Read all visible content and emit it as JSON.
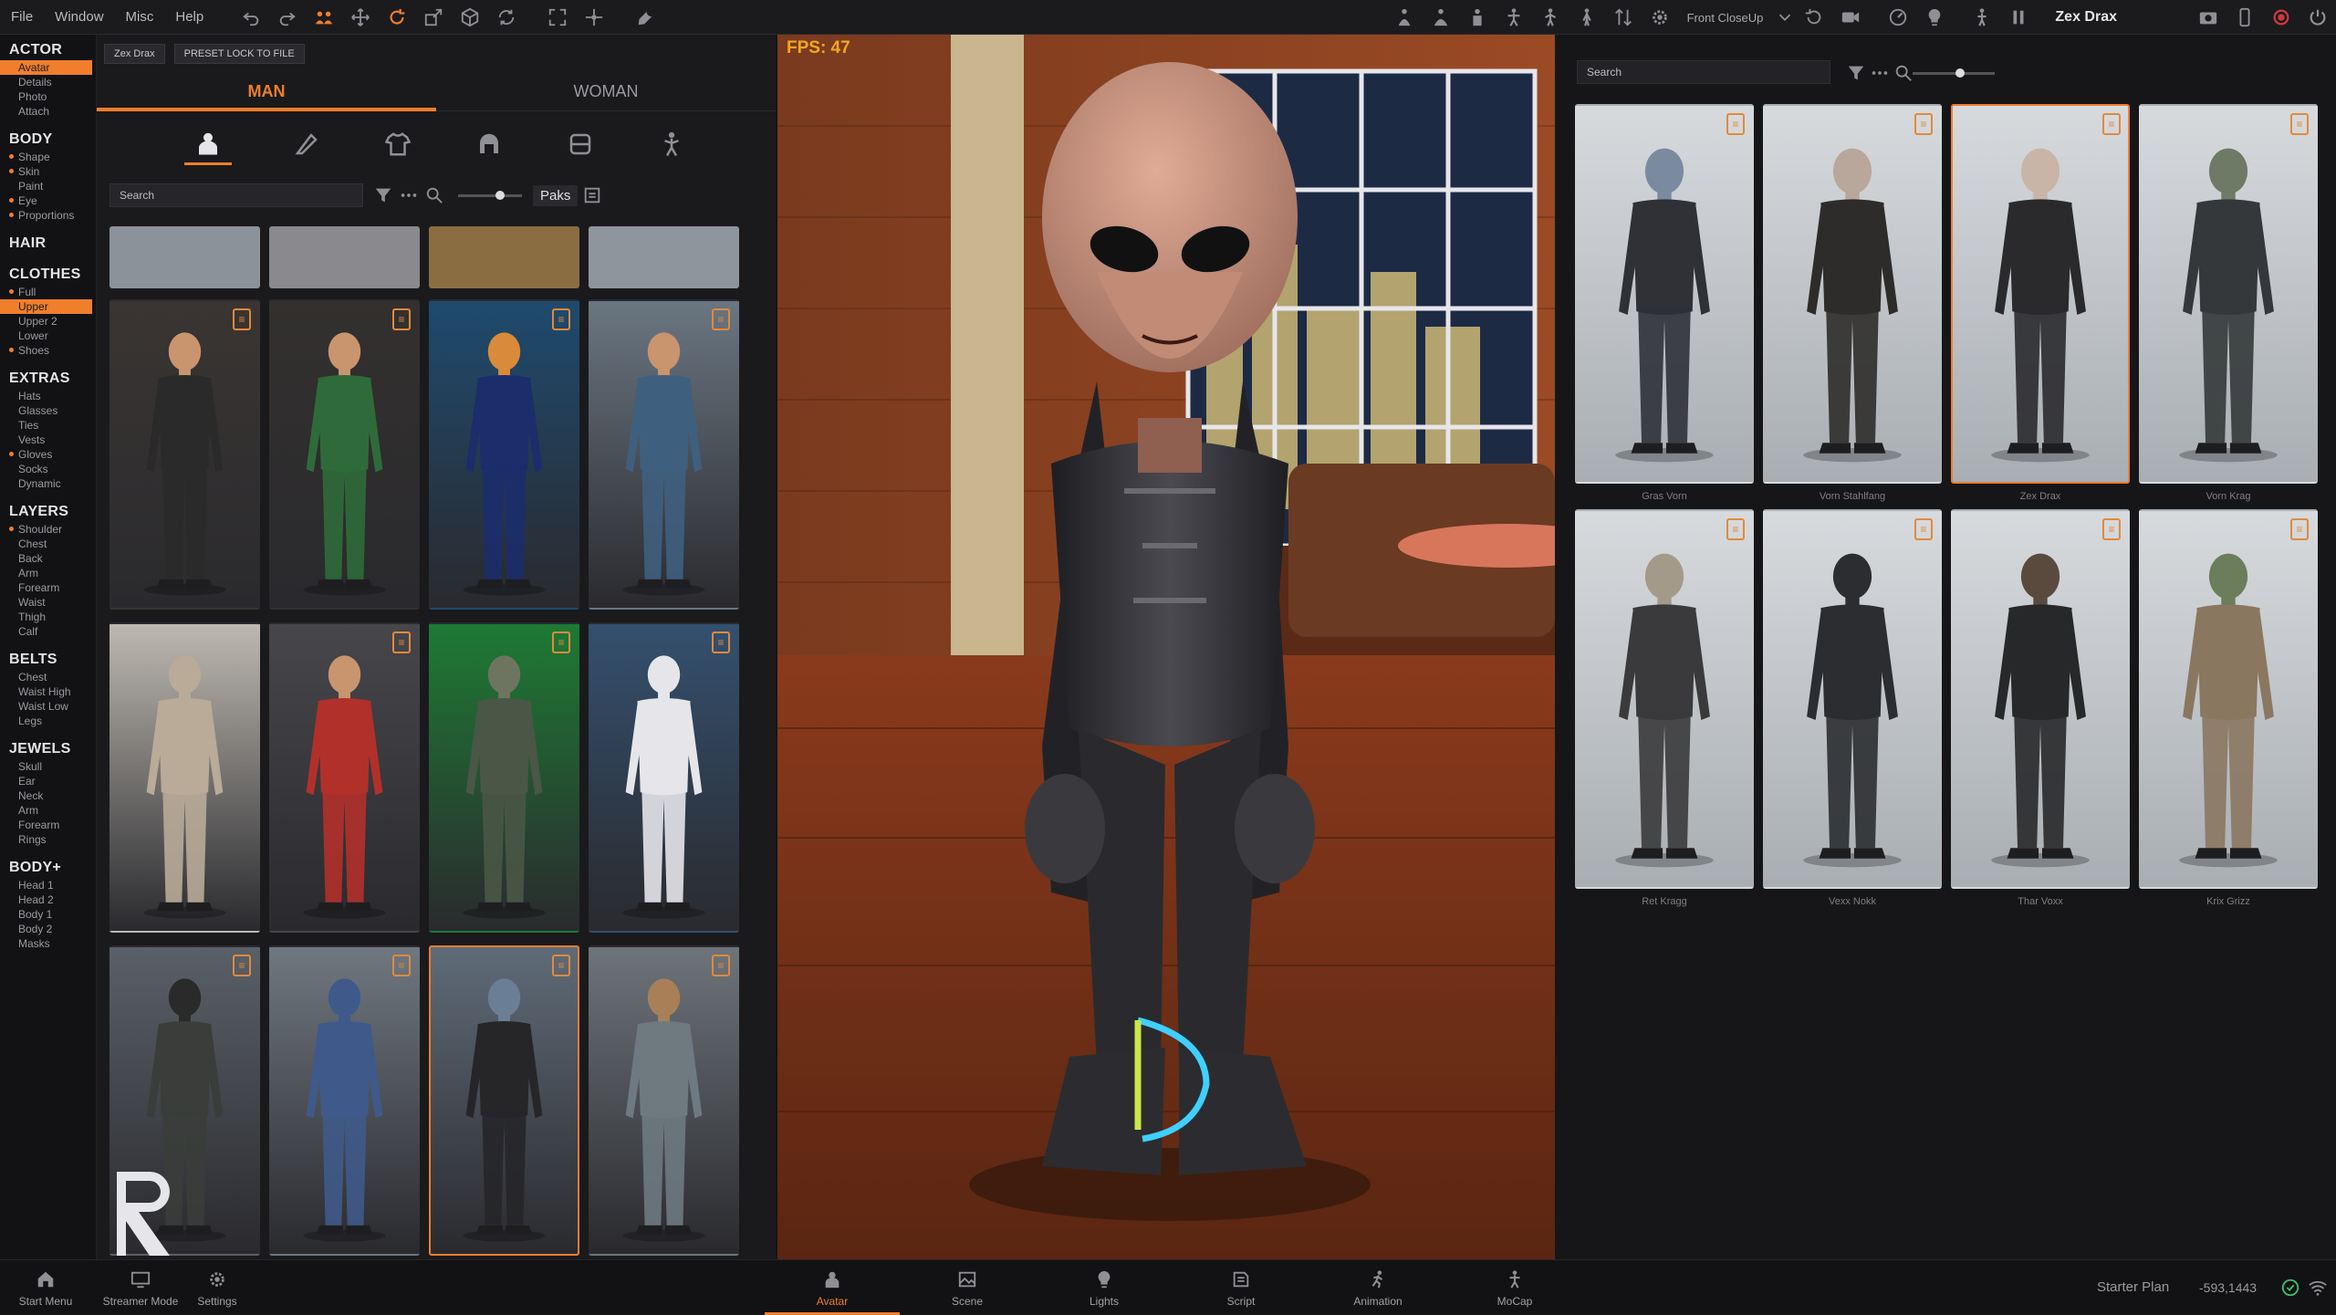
{
  "menu": [
    "File",
    "Window",
    "Misc",
    "Help"
  ],
  "toolbar": {
    "camera": "Front CloseUp",
    "actor": "Zex Drax"
  },
  "leftnav": [
    {
      "title": "ACTOR",
      "items": [
        {
          "label": "Avatar",
          "active": true
        },
        {
          "label": "Details"
        },
        {
          "label": "Photo"
        },
        {
          "label": "Attach"
        }
      ]
    },
    {
      "title": "BODY",
      "items": [
        {
          "label": "Shape",
          "dot": true
        },
        {
          "label": "Skin",
          "dot": true
        },
        {
          "label": "Paint"
        },
        {
          "label": "Eye",
          "dot": true
        },
        {
          "label": "Proportions",
          "dot": true
        }
      ]
    },
    {
      "title": "HAIR",
      "items": []
    },
    {
      "title": "CLOTHES",
      "items": [
        {
          "label": "Full",
          "dot": true
        },
        {
          "label": "Upper",
          "active": true
        },
        {
          "label": "Upper 2"
        },
        {
          "label": "Lower"
        },
        {
          "label": "Shoes",
          "dot": true
        }
      ]
    },
    {
      "title": "EXTRAS",
      "items": [
        {
          "label": "Hats"
        },
        {
          "label": "Glasses"
        },
        {
          "label": "Ties"
        },
        {
          "label": "Vests"
        },
        {
          "label": "Gloves",
          "dot": true
        },
        {
          "label": "Socks"
        },
        {
          "label": "Dynamic"
        }
      ]
    },
    {
      "title": "LAYERS",
      "items": [
        {
          "label": "Shoulder",
          "dot": true
        },
        {
          "label": "Chest"
        },
        {
          "label": "Back"
        },
        {
          "label": "Arm"
        },
        {
          "label": "Forearm"
        },
        {
          "label": "Waist"
        },
        {
          "label": "Thigh"
        },
        {
          "label": "Calf"
        }
      ]
    },
    {
      "title": "BELTS",
      "items": [
        {
          "label": "Chest"
        },
        {
          "label": "Waist High"
        },
        {
          "label": "Waist Low"
        },
        {
          "label": "Legs"
        }
      ]
    },
    {
      "title": "JEWELS",
      "items": [
        {
          "label": "Skull"
        },
        {
          "label": "Ear"
        },
        {
          "label": "Neck"
        },
        {
          "label": "Arm"
        },
        {
          "label": "Forearm"
        },
        {
          "label": "Rings"
        }
      ]
    },
    {
      "title": "BODY+",
      "items": [
        {
          "label": "Head 1"
        },
        {
          "label": "Head 2"
        },
        {
          "label": "Body 1"
        },
        {
          "label": "Body 2"
        },
        {
          "label": "Masks"
        }
      ]
    }
  ],
  "center_panel": {
    "actor_chip": "Zex Drax",
    "preset_chip": "PRESET LOCK TO FILE",
    "tabs": [
      "MAN",
      "WOMAN"
    ],
    "active_tab": "MAN",
    "search_placeholder": "Search",
    "paks_label": "Paks",
    "tiles": [
      {
        "bg": "#3a3532",
        "body": "#2a2a2a",
        "skin": "#c8956f"
      },
      {
        "bg": "#33302e",
        "body": "#2f6b3a",
        "skin": "#c8956f"
      },
      {
        "bg": "#1f4a6e",
        "body": "#1b2d6b",
        "skin": "#d98a3a"
      },
      {
        "bg": "#6a7681",
        "body": "#3f5f7f",
        "skin": "#c8956f"
      },
      {
        "bg": "#bdb8b0",
        "body": "#b9ab98",
        "skin": "#b9ab98"
      },
      {
        "bg": "#47464a",
        "body": "#b2302a",
        "skin": "#c8956f"
      },
      {
        "bg": "#1e7a34",
        "body": "#4a5746",
        "skin": "#6d7560"
      },
      {
        "bg": "#34506e",
        "body": "#e6e6ea",
        "skin": "#e6e6ea"
      },
      {
        "bg": "#5a6068",
        "body": "#3a3d3a",
        "skin": "#2a2a2a"
      },
      {
        "bg": "#6f7780",
        "body": "#3f5a8a",
        "skin": "#3f5a8a"
      },
      {
        "bg": "#5f6b78",
        "body": "#262629",
        "skin": "#6a7f95",
        "selected": true
      },
      {
        "bg": "#6d747a",
        "body": "#6e7a7f",
        "skin": "#a97f58"
      }
    ]
  },
  "viewport": {
    "fps_label": "FPS: 47"
  },
  "right_panel": {
    "search_placeholder": "Search",
    "cards": [
      {
        "name": "Gras Vorn",
        "body": "#2f3137",
        "skin": "#7a8ba0"
      },
      {
        "name": "Vorn Stahlfang",
        "body": "#2e2c2a",
        "skin": "#b8a79a"
      },
      {
        "name": "Zex Drax",
        "body": "#2a2a2d",
        "skin": "#c8b5a8",
        "selected": true
      },
      {
        "name": "Vorn Krag",
        "body": "#34383a",
        "skin": "#6e7a66"
      },
      {
        "name": "Ret Kragg",
        "body": "#3a3a3c",
        "skin": "#a49a8a"
      },
      {
        "name": "Vexx Nokk",
        "body": "#2b2d30",
        "skin": "#2b2d30"
      },
      {
        "name": "Thar Voxx",
        "body": "#27282a",
        "skin": "#5a4a3e"
      },
      {
        "name": "Krix Grizz",
        "body": "#8a7760",
        "skin": "#6b7d5a"
      }
    ]
  },
  "bottombar": {
    "left": [
      "Start Menu",
      "Streamer Mode",
      "Settings"
    ],
    "tabs": [
      "Avatar",
      "Scene",
      "Lights",
      "Script",
      "Animation",
      "MoCap"
    ],
    "active_tab": "Avatar",
    "plan": "Starter Plan",
    "coords": "-593,1443"
  },
  "colors": {
    "accent": "#f07e2d",
    "bg": "#141416",
    "panel": "#1a1a1d"
  }
}
